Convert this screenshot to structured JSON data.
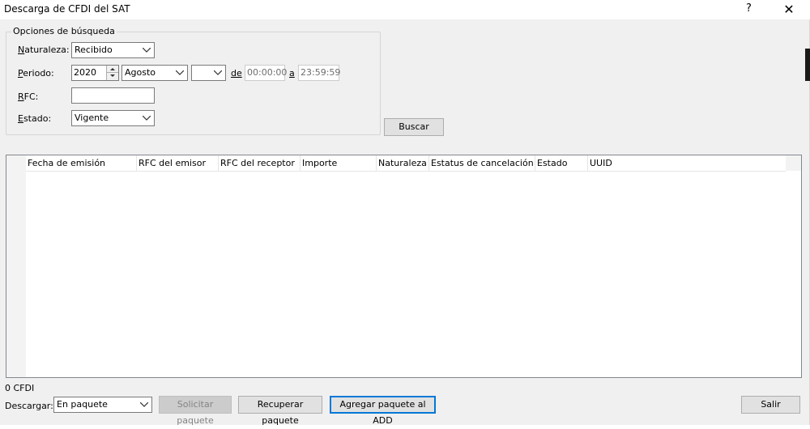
{
  "window": {
    "title": "Descarga de CFDI del SAT",
    "help_glyph": "?",
    "close_glyph": "✕"
  },
  "search": {
    "group_title": "Opciones de búsqueda",
    "naturaleza_label_key": "N",
    "naturaleza_label_rest": "aturaleza:",
    "naturaleza_value": "Recibido",
    "periodo_label_key": "P",
    "periodo_label_rest": "eriodo:",
    "year_value": "2020",
    "month_value": "Agosto",
    "day_value": "",
    "de_label": "de",
    "time_from": "00:00:00",
    "a_label": "a",
    "time_to": "23:59:59",
    "rfc_label_key": "R",
    "rfc_label_rest": "FC:",
    "rfc_value": "",
    "estado_label_key": "E",
    "estado_label_rest": "stado:",
    "estado_value": "Vigente",
    "buscar_label": "Buscar"
  },
  "table": {
    "columns": [
      {
        "label": "Fecha de emisión"
      },
      {
        "label": "RFC del emisor"
      },
      {
        "label": "RFC del receptor"
      },
      {
        "label": "Importe"
      },
      {
        "label": "Naturaleza"
      },
      {
        "label": "Estatus de cancelación"
      },
      {
        "label": "Estado"
      },
      {
        "label": "UUID"
      }
    ],
    "rows": []
  },
  "status": {
    "count_text": "0 CFDI"
  },
  "bottom": {
    "descargar_label": "Descargar:",
    "descargar_value": "En paquete",
    "solicitar_label": "Solicitar paquete",
    "recuperar_label": "Recuperar paquete",
    "agregar_label": "Agregar paquete al ADD",
    "salir_label": "Salir"
  },
  "colors": {
    "dialog_bg": "#f0f0f0",
    "focus_border": "#0078d7",
    "disabled_button": "#cccccc"
  }
}
